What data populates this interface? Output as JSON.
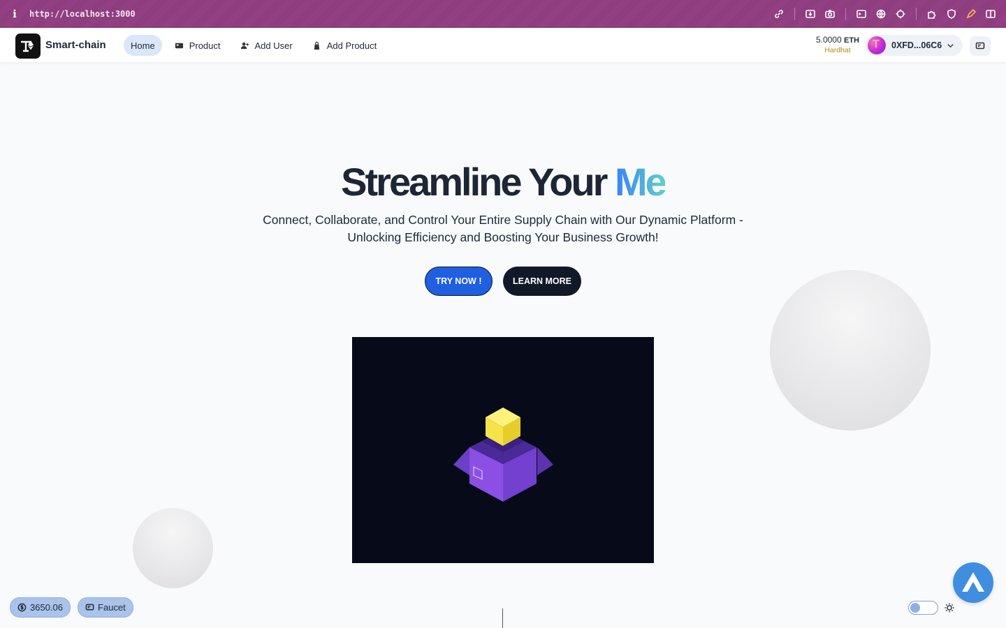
{
  "browser": {
    "url": "http://localhost:3000",
    "info_glyph": "i"
  },
  "nav": {
    "brand": "Smart-chain",
    "links": [
      {
        "label": "Home",
        "icon": "home",
        "active": true
      },
      {
        "label": "Product",
        "icon": "product-icon"
      },
      {
        "label": "Add User",
        "icon": "add-user-icon"
      },
      {
        "label": "Add Product",
        "icon": "bag-icon"
      }
    ],
    "balance": "5.0000",
    "currency": "ETH",
    "network": "Hardhat",
    "account": "0XFD...06C6"
  },
  "hero": {
    "title_main": "Streamline Your",
    "title_accent": "Me",
    "subtitle": "Connect, Collaborate, and Control Your Entire Supply Chain with Our Dynamic Platform - Unlocking Efficiency and Boosting Your Business Growth!",
    "try_button": "TRY NOW !",
    "learn_button": "LEARN MORE"
  },
  "footer": {
    "balance_pill": "3650.06",
    "faucet_pill": "Faucet"
  },
  "colors": {
    "browser_bar": "#8e3d7f",
    "primary_button": "#1f5fe0",
    "dark_button": "#111827",
    "accent_gradient_start": "#3b82f6",
    "accent_gradient_end": "#5fd0c9",
    "network_label": "#b78a0d"
  }
}
